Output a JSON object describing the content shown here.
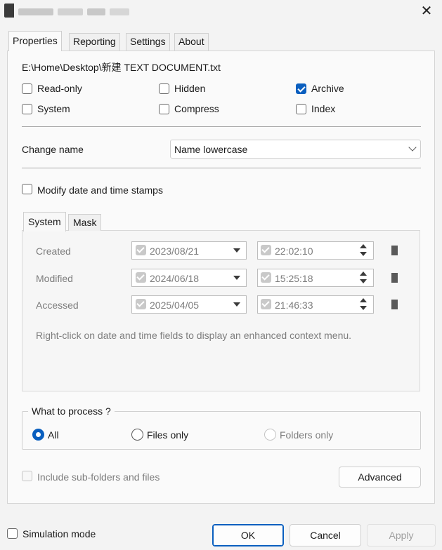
{
  "window": {
    "close_glyph": "✕"
  },
  "tabs": [
    "Properties",
    "Reporting",
    "Settings",
    "About"
  ],
  "file_path": "E:\\Home\\Desktop\\新建 TEXT DOCUMENT.txt",
  "attributes": {
    "read_only": {
      "label": "Read-only",
      "checked": false
    },
    "hidden": {
      "label": "Hidden",
      "checked": false
    },
    "archive": {
      "label": "Archive",
      "checked": true
    },
    "system": {
      "label": "System",
      "checked": false
    },
    "compress": {
      "label": "Compress",
      "checked": false
    },
    "index": {
      "label": "Index",
      "checked": false
    }
  },
  "change_name": {
    "label": "Change name",
    "value": "Name lowercase"
  },
  "modify_stamps": {
    "label": "Modify date and time stamps",
    "checked": false
  },
  "inner_tabs": [
    "System",
    "Mask"
  ],
  "stamps": [
    {
      "label": "Created",
      "date": "2023/08/21",
      "time": "22:02:10"
    },
    {
      "label": "Modified",
      "date": "2024/06/18",
      "time": "15:25:18"
    },
    {
      "label": "Accessed",
      "date": "2025/04/05",
      "time": "21:46:33"
    }
  ],
  "hint": "Right-click on date and time fields to display an enhanced context menu.",
  "process": {
    "label": "What to process ?",
    "options": [
      "All",
      "Files only",
      "Folders only"
    ],
    "selected": "All"
  },
  "include_sub": {
    "label": "Include sub-folders and files",
    "enabled": false
  },
  "advanced_label": "Advanced",
  "simulation": {
    "label": "Simulation mode",
    "checked": false
  },
  "buttons": {
    "ok": "OK",
    "cancel": "Cancel",
    "apply": "Apply"
  },
  "colors": {
    "accent": "#0a5fbf",
    "background": "#f3f3f3"
  }
}
